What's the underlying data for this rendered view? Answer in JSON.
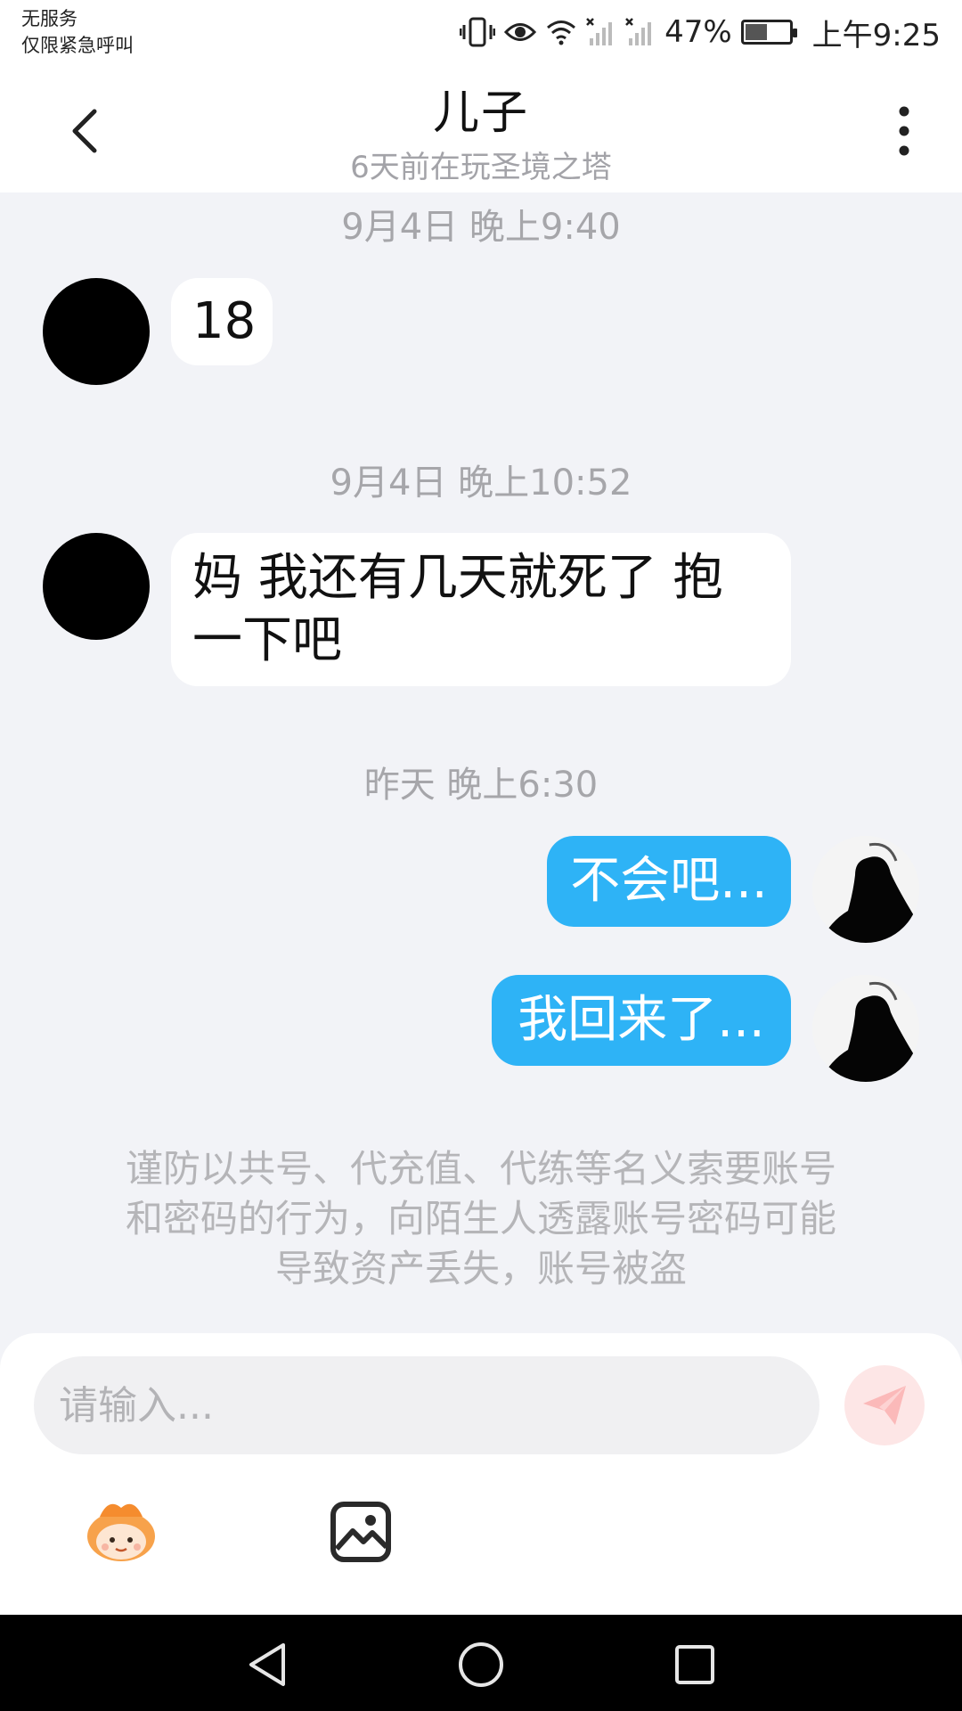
{
  "status_bar": {
    "carrier_line1": "无服务",
    "carrier_line2": "仅限紧急呼叫",
    "battery": "47%",
    "battery_level": 0.47,
    "time": "上午9:25",
    "icons": [
      "vibrate-icon",
      "eye-icon",
      "wifi-icon",
      "signal-off-icon",
      "signal-off-icon",
      "battery-charging-icon"
    ]
  },
  "header": {
    "title": "儿子",
    "subtitle": "6天前在玩圣境之塔"
  },
  "messages": [
    {
      "timestamp": "9月4日 晚上9:40",
      "direction": "incoming",
      "text": "18"
    },
    {
      "timestamp": "9月4日 晚上10:52",
      "direction": "incoming",
      "text_line1": "妈 我还有几天就死了 抱",
      "text_line2": "一下吧"
    },
    {
      "timestamp": "昨天 晚上6:30",
      "direction": "outgoing",
      "text": "不会吧..."
    },
    {
      "direction": "outgoing",
      "text": "我回来了..."
    }
  ],
  "notice": {
    "line1": "谨防以共号、代充值、代练等名义索要账号",
    "line2": "和密码的行为，向陌生人透露账号密码可能",
    "line3": "导致资产丢失，账号被盗"
  },
  "composer": {
    "placeholder": "请输入...",
    "send_icon": "send-icon",
    "tools": [
      "emoji-icon",
      "image-icon"
    ]
  },
  "colors": {
    "outgoing_bubble": "#2eb3f6",
    "chat_background": "#f2f3f7",
    "send_button": "#fde6e6"
  }
}
